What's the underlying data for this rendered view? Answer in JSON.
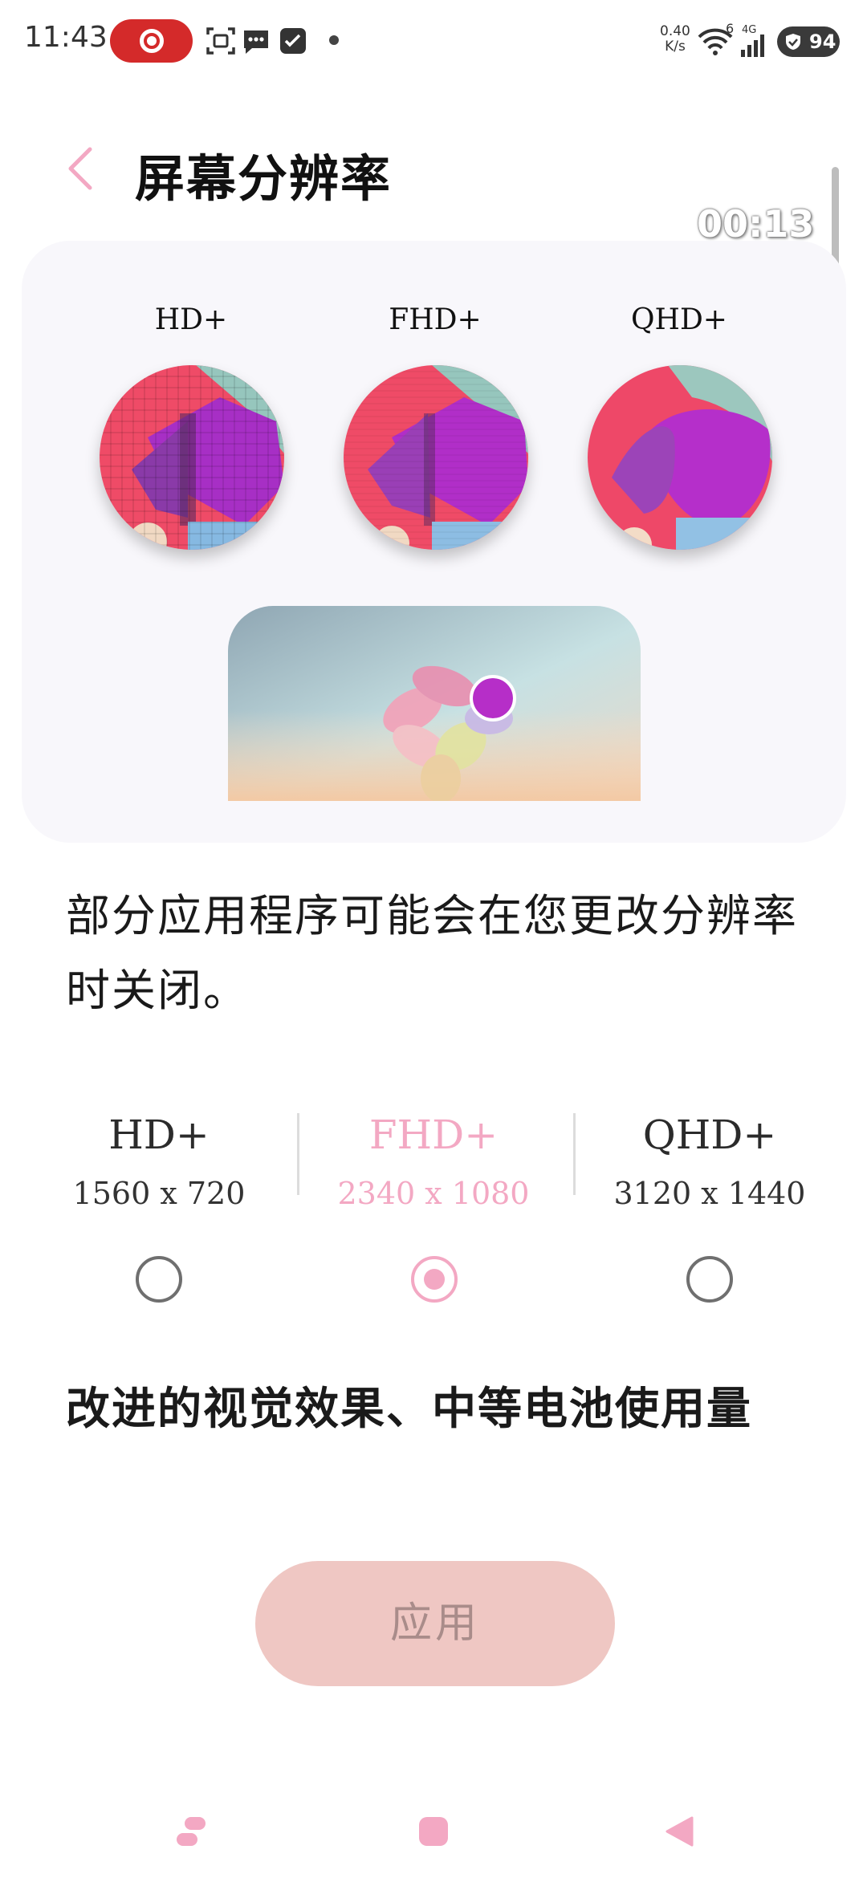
{
  "status_bar": {
    "time": "11:43",
    "speed_value": "0.40",
    "speed_unit": "K/s",
    "signal_sup": "6",
    "network": "4G",
    "battery": "94",
    "icons": [
      "screen-record-icon",
      "screenshot-icon",
      "message-icon",
      "check-icon",
      "wifi-icon",
      "signal-icon",
      "battery-icon"
    ]
  },
  "header": {
    "title": "屏幕分辨率",
    "back_icon": "chevron-left-icon"
  },
  "recording_timer": "00:13",
  "preview": {
    "captions": [
      "HD+",
      "FHD+",
      "QHD+"
    ]
  },
  "note": "部分应用程序可能会在您更改分辨率时关闭。",
  "options": [
    {
      "name": "HD+",
      "dims": "1560 x 720",
      "selected": false
    },
    {
      "name": "FHD+",
      "dims": "2340 x 1080",
      "selected": true
    },
    {
      "name": "QHD+",
      "dims": "3120 x 1440",
      "selected": false
    }
  ],
  "effect_text": "改进的视觉效果、中等电池使用量",
  "apply_label": "应用",
  "colors": {
    "accent": "#f3a8c3",
    "apply_bg": "#efc7c3",
    "record_red": "#d42a2a",
    "card_bg": "#f8f7fb"
  }
}
